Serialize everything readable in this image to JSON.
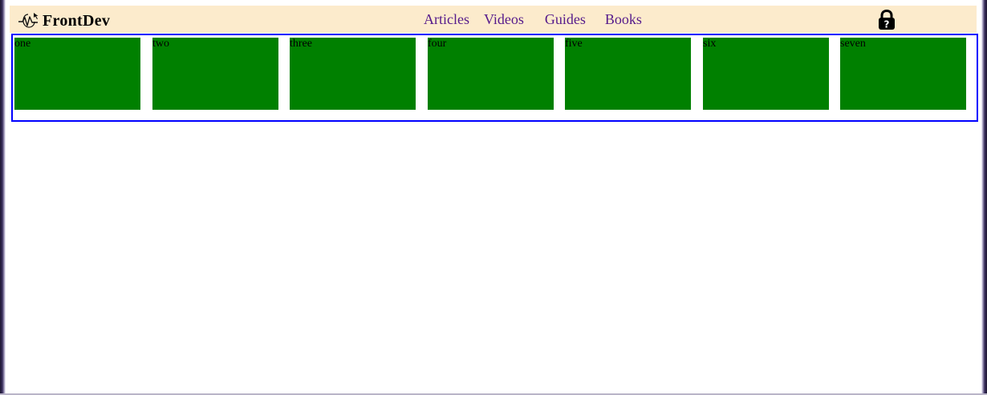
{
  "brand": {
    "logo_icon": "waveform-cursor-icon",
    "name": "FrontDev"
  },
  "nav": {
    "links": [
      "Articles",
      "Videos",
      "Guides",
      "Books"
    ],
    "link_color": "#551a8b"
  },
  "account": {
    "icon": "lock-question-icon"
  },
  "boxes": {
    "labels": [
      "one",
      "two",
      "three",
      "four",
      "five",
      "six",
      "seven"
    ],
    "fill_color": "#008000",
    "border_color": "#0000ff"
  },
  "colors": {
    "header_background": "#fcebcc",
    "page_background": "#ffffff"
  }
}
